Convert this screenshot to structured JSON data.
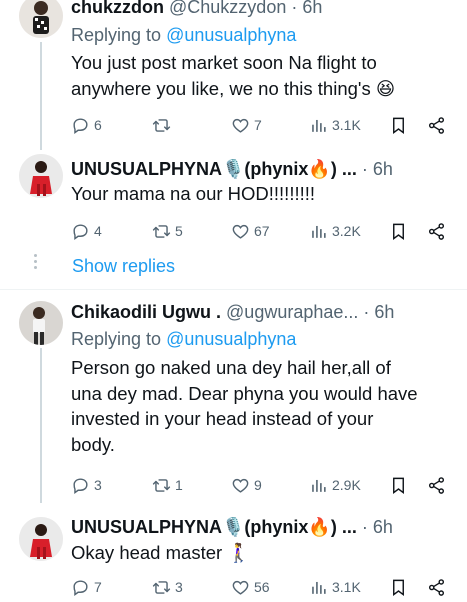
{
  "tweets": [
    {
      "name": "chukzzdon",
      "handle": "@Chukzzydon",
      "sep": "·",
      "time": "6h",
      "replying_prefix": "Replying to ",
      "replying_to": "@unusualphyna",
      "lines": [
        "You just post market soon Na flight to",
        "anywhere you like, we no this thing's 😆"
      ],
      "replies": "6",
      "retweets": "",
      "likes": "7",
      "views": "3.1K"
    },
    {
      "name": "UNUSUALPHYNA🎙️(phynix🔥) ...",
      "sep": "·",
      "time": "6h",
      "lines": [
        "Your mama na our HOD!!!!!!!!!"
      ],
      "replies": "4",
      "retweets": "5",
      "likes": "67",
      "views": "3.2K"
    },
    {
      "name": "Chikaodili Ugwu .",
      "handle": "@ugwuraphae...",
      "sep": "·",
      "time": "6h",
      "replying_prefix": "Replying to ",
      "replying_to": "@unusualphyna",
      "lines": [
        "Person go naked una dey hail her,all of",
        "una dey mad. Dear phyna you would have",
        "invested in your head instead of your",
        "body."
      ],
      "replies": "3",
      "retweets": "1",
      "likes": "9",
      "views": "2.9K"
    },
    {
      "name": "UNUSUALPHYNA🎙️(phynix🔥) ...",
      "sep": "·",
      "time": "6h",
      "lines": [
        "Okay head master 🚶‍♀️"
      ],
      "replies": "7",
      "retweets": "3",
      "likes": "56",
      "views": "3.1K"
    }
  ],
  "show_replies": "Show replies",
  "icons": [
    "reply-icon",
    "retweet-icon",
    "like-icon",
    "views-icon",
    "bookmark-icon",
    "share-icon"
  ],
  "colors": {
    "link": "#1d9bf0",
    "muted": "#536471",
    "text": "#0f1419"
  }
}
